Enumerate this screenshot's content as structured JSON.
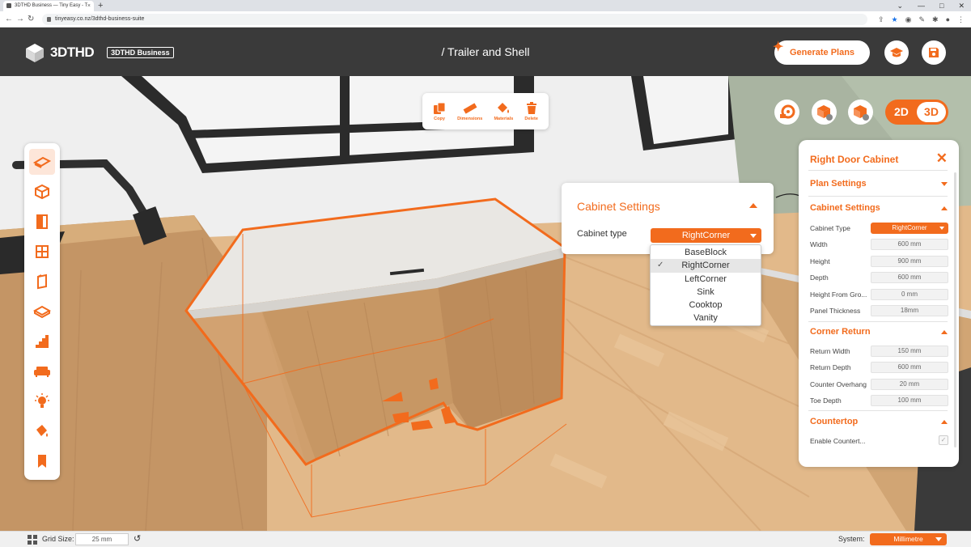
{
  "browser": {
    "tab_title": "3DTHD Business — Tiny Easy - T",
    "tab_close": "×",
    "new_tab": "+",
    "url": "tinyeasy.co.nz/3dthd-business-suite",
    "back": "←",
    "forward": "→",
    "reload": "↻",
    "win_minimize": "⌄",
    "win_min": "—",
    "win_max": "□",
    "win_close": "✕"
  },
  "header": {
    "logo_text": "3DTHD",
    "logo_badge": "3DTHD Business",
    "title": "/ Trailer and Shell",
    "generate_plans": "Generate Plans"
  },
  "float_toolbar": {
    "copy": "Copy",
    "dimensions": "Dimensions",
    "materials": "Materials",
    "delete": "Delete"
  },
  "view_toggle": {
    "mode_2d": "2D",
    "mode_3d": "3D",
    "active": "3D"
  },
  "cabinet_popup": {
    "title": "Cabinet Settings",
    "type_label": "Cabinet type",
    "selected": "RightCorner",
    "options": [
      "BaseBlock",
      "RightCorner",
      "LeftCorner",
      "Sink",
      "Cooktop",
      "Vanity"
    ],
    "check": "✓"
  },
  "panel": {
    "title": "Right Door Cabinet",
    "close": "✕",
    "sections": {
      "plan": "Plan Settings",
      "cabinet": "Cabinet Settings",
      "corner": "Corner Return",
      "countertop": "Countertop"
    },
    "cabinet_type_label": "Cabinet Type",
    "cabinet_type_value": "RightCorner",
    "width_label": "Width",
    "width_value": "600 mm",
    "height_label": "Height",
    "height_value": "900 mm",
    "depth_label": "Depth",
    "depth_value": "600 mm",
    "hfg_label": "Height From Gro...",
    "hfg_value": "0 mm",
    "panel_label": "Panel Thickness",
    "panel_value": "18mm",
    "rw_label": "Return Width",
    "rw_value": "150 mm",
    "rd_label": "Return Depth",
    "rd_value": "600 mm",
    "co_label": "Counter Overhang",
    "co_value": "20 mm",
    "td_label": "Toe Depth",
    "td_value": "100 mm",
    "ec_label": "Enable Countert...",
    "ec_checked": true,
    "ec_check": "✓"
  },
  "status": {
    "grid_label": "Grid Size:",
    "grid_value": "25 mm",
    "reset": "↺",
    "system_label": "System:",
    "system_value": "Millimetre"
  },
  "colors": {
    "accent": "#f26b1d",
    "header_bg": "#3a3a3a",
    "wood": "#c89a68",
    "floor": "#e0b887"
  },
  "icons": {
    "left_toolbar": [
      "floor-icon",
      "walls-icon",
      "door-icon",
      "window-icon",
      "panel-icon",
      "slab-icon",
      "stairs-icon",
      "sofa-icon",
      "light-icon",
      "paint-icon",
      "bookmark-icon"
    ]
  }
}
